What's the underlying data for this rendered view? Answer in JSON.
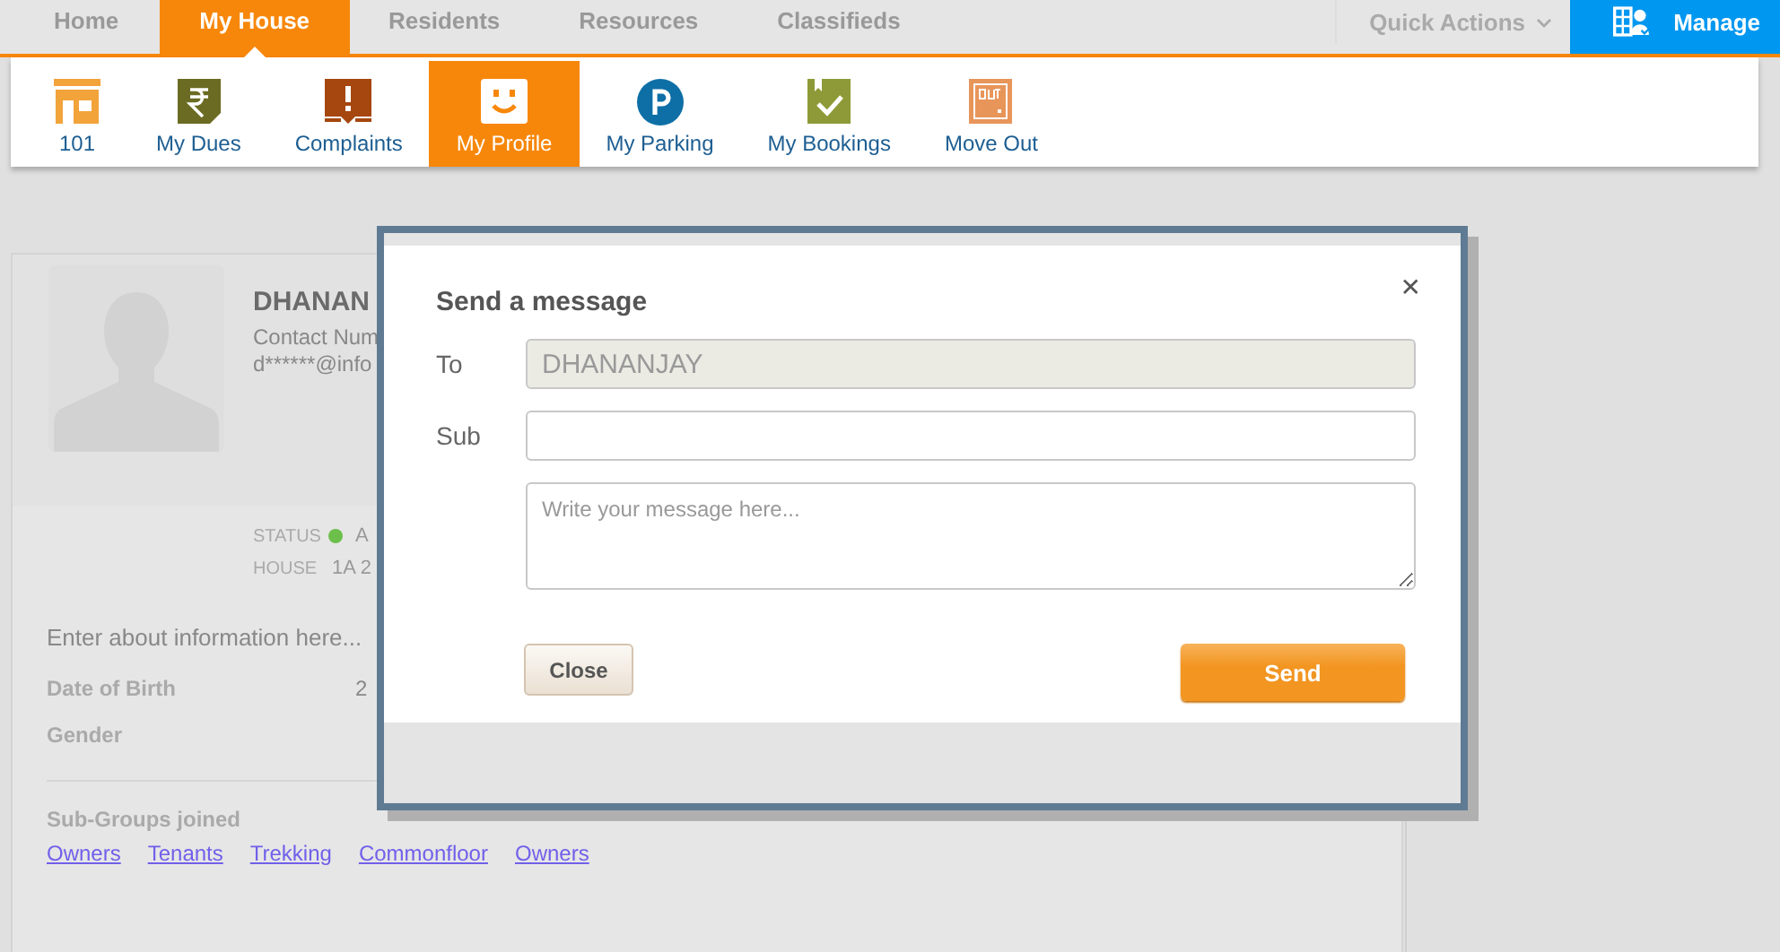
{
  "top_nav": {
    "tabs": [
      {
        "label": "Home",
        "selected": false
      },
      {
        "label": "My House",
        "selected": true
      },
      {
        "label": "Residents",
        "selected": false
      },
      {
        "label": "Resources",
        "selected": false
      },
      {
        "label": "Classifieds",
        "selected": false
      }
    ],
    "quick_actions": "Quick Actions",
    "manage": "Manage"
  },
  "sub_nav": [
    {
      "label": "101",
      "kind": "house",
      "selected": false
    },
    {
      "label": "My Dues",
      "kind": "dues",
      "selected": false
    },
    {
      "label": "Complaints",
      "kind": "complaint",
      "selected": false
    },
    {
      "label": "My Profile",
      "kind": "profile",
      "selected": true
    },
    {
      "label": "My Parking",
      "kind": "parking",
      "selected": false
    },
    {
      "label": "My Bookings",
      "kind": "booking",
      "selected": false
    },
    {
      "label": "Move Out",
      "kind": "moveout",
      "selected": false
    }
  ],
  "profile": {
    "name": "DHANAN",
    "contact": "Contact Num",
    "email": "d******@info",
    "status": {
      "label": "STATUS",
      "value": "A",
      "color": "#6dbf4b"
    },
    "house_label": "HOUSE",
    "house_value": "1A 2",
    "about": "Enter about information here...",
    "details": [
      {
        "label": "Date of Birth",
        "value": "2"
      },
      {
        "label": "Gender"
      }
    ],
    "subgroups_title": "Sub-Groups joined",
    "subgroups": [
      "Owners",
      "Tenants",
      "Trekking",
      "Commonfloor",
      "Owners"
    ]
  },
  "dialog": {
    "title": "Send a message",
    "close_icon": "✕",
    "to_label": "To",
    "to_value": "DHANANJAY",
    "sub_label": "Sub",
    "message_placeholder": "Write your message here...",
    "buttons": [
      {
        "label": "Close",
        "kind": "secondary"
      },
      {
        "label": "Send",
        "kind": "primary"
      }
    ]
  }
}
